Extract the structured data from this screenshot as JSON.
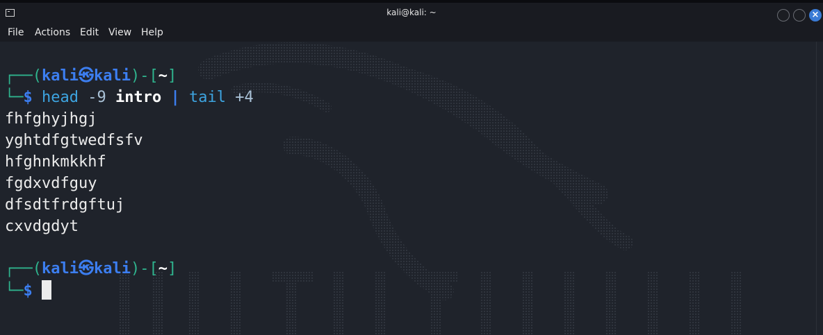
{
  "window": {
    "title": "kali@kali: ~",
    "close_glyph": "×",
    "icon": "terminal-icon"
  },
  "menu": {
    "file": "File",
    "actions": "Actions",
    "edit": "Edit",
    "view": "View",
    "help": "Help"
  },
  "prompt1": {
    "corner": "┌──(",
    "user": "kali",
    "sep_glyph": "㉿",
    "host": "kali",
    "mid": ")-[",
    "path": "~",
    "end": "]",
    "corner2": "└─",
    "dollar": "$"
  },
  "command": {
    "cmd1": "head",
    "arg1": "-9",
    "file": "intro",
    "pipe": "|",
    "cmd2": "tail",
    "arg2": "+4"
  },
  "output": [
    "fhfghyjhgj",
    "yghtdfgtwedfsfv",
    "hfghnkmkkhf",
    "fgdxvdfguy",
    "dfsdtfrdgftuj",
    "cxvdgdyt"
  ],
  "prompt2": {
    "corner": "┌──(",
    "user": "kali",
    "sep_glyph": "㉿",
    "host": "kali",
    "mid": ")-[",
    "path": "~",
    "end": "]",
    "corner2": "└─",
    "dollar": "$"
  },
  "colors": {
    "background": "#1f232b",
    "prompt_frame": "#2fb48e",
    "prompt_user": "#3c7ef0",
    "command": "#3da4e0",
    "close_button": "#3a7bd5"
  }
}
